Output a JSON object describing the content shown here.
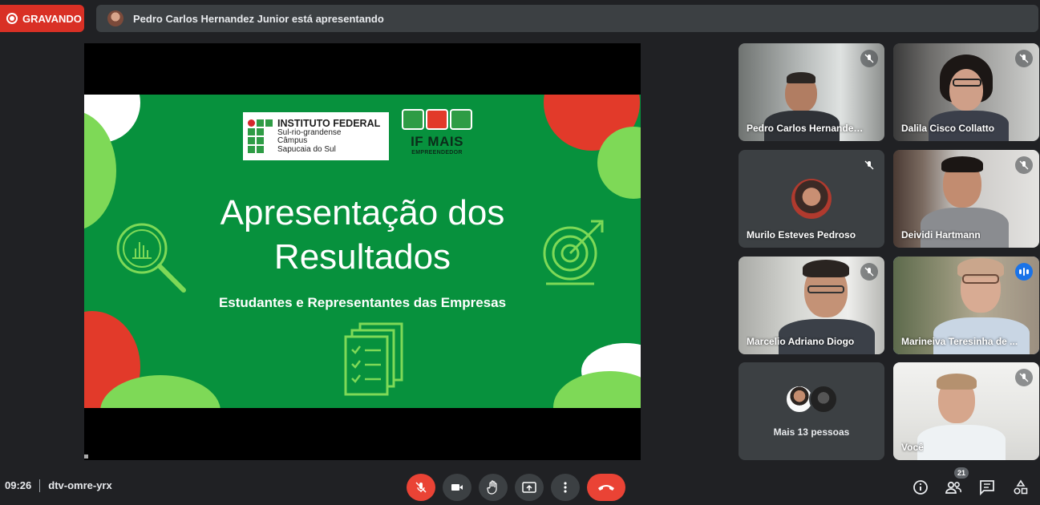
{
  "recording": {
    "label": "GRAVANDO"
  },
  "presenting_bar": {
    "text": "Pedro Carlos Hernandez Junior está apresentando"
  },
  "slide": {
    "logo_title": "INSTITUTO FEDERAL",
    "logo_line1": "Sul-rio-grandense",
    "logo_line2": "Câmpus",
    "logo_line3": "Sapucaia do Sul",
    "brand_title": "IF MAIS",
    "brand_sub": "EMPREENDEDOR",
    "title_line1": "Apresentação dos",
    "title_line2": "Resultados",
    "subtitle": "Estudantes e Representantes das Empresas",
    "colors": {
      "green": "#07913d",
      "light_green": "#7ed957",
      "red": "#e23a2a",
      "white": "#ffffff"
    }
  },
  "participants": [
    {
      "name": "Pedro Carlos Hernandez ...",
      "muted": true,
      "speaking": false
    },
    {
      "name": "Dalila Cisco Collatto",
      "muted": true,
      "speaking": false
    },
    {
      "name": "Murilo Esteves Pedroso",
      "muted": true,
      "speaking": false,
      "camera_off": true
    },
    {
      "name": "Deividi Hartmann",
      "muted": true,
      "speaking": false
    },
    {
      "name": "Marcelio Adriano Diogo",
      "muted": true,
      "speaking": false
    },
    {
      "name": "Marineiva Teresinha de ...",
      "muted": false,
      "speaking": true
    },
    {
      "name": "Mais 13 pessoas",
      "overflow": true
    },
    {
      "name": "Você",
      "muted": true,
      "speaking": false
    }
  ],
  "bottom": {
    "time": "09:26",
    "meeting_code": "dtv-omre-yrx",
    "controls": [
      "mic-off-icon",
      "camera-icon",
      "raise-hand-icon",
      "present-icon",
      "more-options-icon",
      "hang-up-icon"
    ],
    "right_icons": [
      "info-icon",
      "people-icon",
      "chat-icon",
      "activities-icon"
    ],
    "participant_count": "21"
  }
}
